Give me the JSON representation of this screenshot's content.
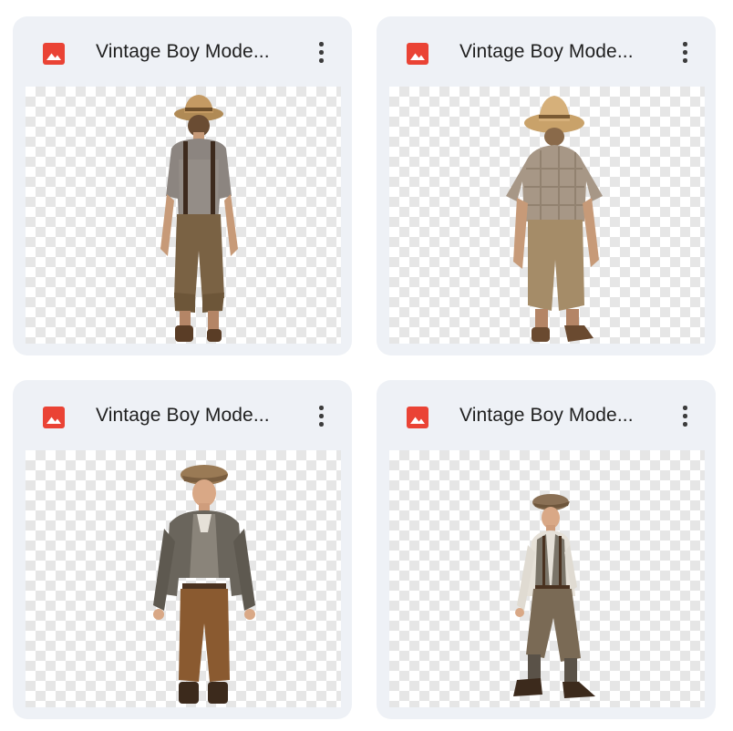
{
  "files": [
    {
      "title": "Vintage Boy Mode...",
      "icon": "image-file-icon",
      "menu_icon": "more-vert-icon",
      "figure": "boy-back-view-hat-suspenders"
    },
    {
      "title": "Vintage Boy Mode...",
      "icon": "image-file-icon",
      "menu_icon": "more-vert-icon",
      "figure": "boy-back-view-straw-hat-plaid"
    },
    {
      "title": "Vintage Boy Mode...",
      "icon": "image-file-icon",
      "menu_icon": "more-vert-icon",
      "figure": "boy-front-view-flat-cap-jacket"
    },
    {
      "title": "Vintage Boy Mode...",
      "icon": "image-file-icon",
      "menu_icon": "more-vert-icon",
      "figure": "boy-walking-flat-cap-vest"
    }
  ],
  "colors": {
    "card_background": "#eef1f6",
    "image_icon_red": "#ea4335",
    "title_text": "#1f1f1f"
  }
}
